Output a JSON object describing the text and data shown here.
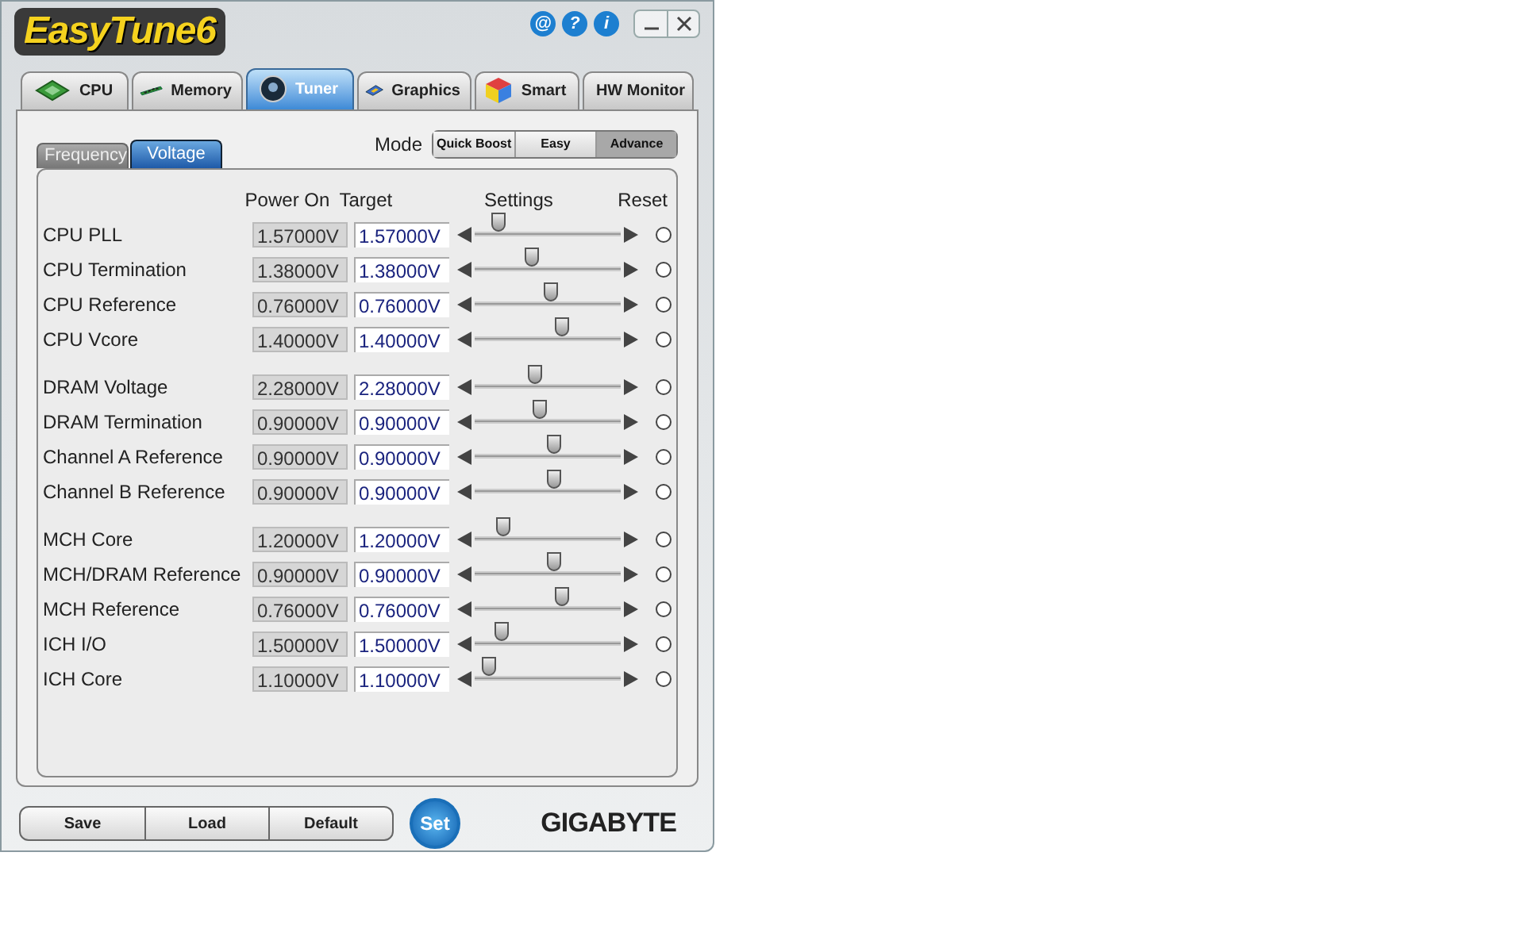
{
  "window": {
    "title": "EasyTune6",
    "title_icons": [
      "@",
      "?",
      "i"
    ]
  },
  "tabs": [
    {
      "label": "CPU",
      "selected": false
    },
    {
      "label": "Memory",
      "selected": false
    },
    {
      "label": "Tuner",
      "selected": true
    },
    {
      "label": "Graphics",
      "selected": false
    },
    {
      "label": "Smart",
      "selected": false
    },
    {
      "label": "HW Monitor",
      "selected": false
    }
  ],
  "subtabs": [
    {
      "label": "Frequency",
      "selected": false
    },
    {
      "label": "Voltage",
      "selected": true
    }
  ],
  "mode": {
    "label": "Mode",
    "options": [
      {
        "label": "Quick Boost",
        "selected": false
      },
      {
        "label": "Easy",
        "selected": false
      },
      {
        "label": "Advance",
        "selected": true
      }
    ]
  },
  "columns": [
    "Power On",
    "Target",
    "Settings",
    "Reset"
  ],
  "groups": [
    {
      "rows": [
        {
          "name": "CPU PLL",
          "power_on": "1.57000V",
          "target": "1.57000V",
          "level": 0.13,
          "selected": false
        },
        {
          "name": "CPU Termination",
          "power_on": "1.38000V",
          "target": "1.38000V",
          "level": 0.38,
          "selected": false
        },
        {
          "name": "CPU Reference",
          "power_on": "0.76000V",
          "target": "0.76000V",
          "level": 0.52,
          "selected": false
        },
        {
          "name": "CPU Vcore",
          "power_on": "1.40000V",
          "target": "1.40000V",
          "level": 0.61,
          "selected": false
        }
      ]
    },
    {
      "rows": [
        {
          "name": "DRAM Voltage",
          "power_on": "2.28000V",
          "target": "2.28000V",
          "level": 0.41,
          "selected": false
        },
        {
          "name": "DRAM Termination",
          "power_on": "0.90000V",
          "target": "0.90000V",
          "level": 0.44,
          "selected": false
        },
        {
          "name": "Channel A Reference",
          "power_on": "0.90000V",
          "target": "0.90000V",
          "level": 0.55,
          "selected": false
        },
        {
          "name": "Channel B Reference",
          "power_on": "0.90000V",
          "target": "0.90000V",
          "level": 0.55,
          "selected": false
        }
      ]
    },
    {
      "rows": [
        {
          "name": "MCH Core",
          "power_on": "1.20000V",
          "target": "1.20000V",
          "level": 0.17,
          "selected": false
        },
        {
          "name": "MCH/DRAM Reference",
          "power_on": "0.90000V",
          "target": "0.90000V",
          "level": 0.55,
          "selected": false
        },
        {
          "name": "MCH Reference",
          "power_on": "0.76000V",
          "target": "0.76000V",
          "level": 0.61,
          "selected": false
        },
        {
          "name": "ICH I/O",
          "power_on": "1.50000V",
          "target": "1.50000V",
          "level": 0.16,
          "selected": false
        },
        {
          "name": "ICH Core",
          "power_on": "1.10000V",
          "target": "1.10000V",
          "level": 0.06,
          "selected": false
        }
      ]
    }
  ],
  "bottom_buttons": [
    "Save",
    "Load",
    "Default"
  ],
  "set_button": "Set",
  "brand": "GIGABYTE"
}
